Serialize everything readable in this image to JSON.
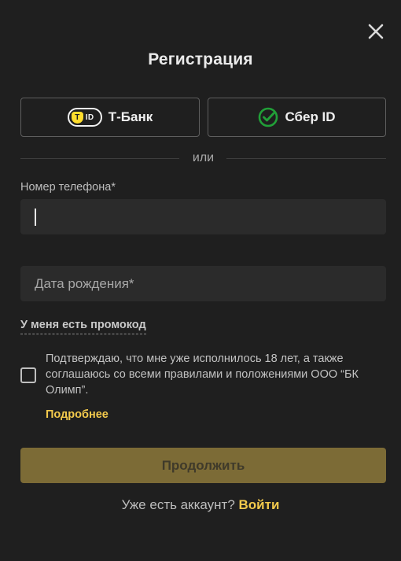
{
  "title": "Регистрация",
  "close_icon": "close-icon",
  "sso": {
    "tbank": {
      "badge_text": "ID",
      "label": "Т-Банк",
      "icon": "tbank-id-icon",
      "accent": "#ffdd2d"
    },
    "sber": {
      "label": "Сбер ID",
      "icon": "sber-check-icon",
      "accent": "#21a038"
    }
  },
  "divider_text": "или",
  "phone": {
    "label": "Номер телефона*",
    "value": ""
  },
  "birth_date": {
    "placeholder": "Дата рождения*",
    "value": ""
  },
  "promo_link": "У меня есть промокод",
  "terms": {
    "text": "Подтверждаю, что мне уже исполнилось 18 лет, а также соглашаюсь со всеми правилами и положениями ООО “БК Олимп”.",
    "checked": false,
    "more_link": "Подробнее"
  },
  "continue_label": "Продолжить",
  "footer": {
    "question": "Уже есть аккаунт?",
    "login_link": "Войти"
  },
  "colors": {
    "accent": "#f2c94c",
    "button_disabled": "#7c6b36",
    "background": "#1f1f1f"
  }
}
